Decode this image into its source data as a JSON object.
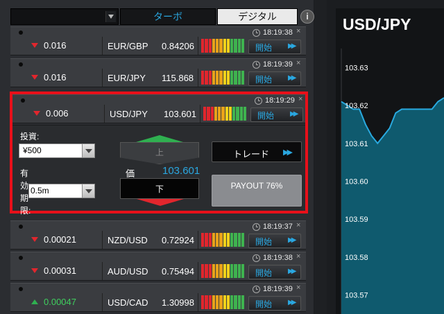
{
  "topbar": {
    "tab_turbo": "ターボ",
    "tab_digital": "デジタル",
    "info_label": "i"
  },
  "rows_top": [
    {
      "time": "18:19:38",
      "direction": "down",
      "change": "0.016",
      "pair": "EUR/GBP",
      "price": "0.84206",
      "button": "開始"
    },
    {
      "time": "18:19:39",
      "direction": "down",
      "change": "0.016",
      "pair": "EUR/JPY",
      "price": "115.868",
      "button": "開始"
    }
  ],
  "expanded": {
    "time": "18:19:29",
    "direction": "down",
    "change": "0.006",
    "pair": "USD/JPY",
    "price": "103.601",
    "button": "開始",
    "label_investment": "投資:",
    "amount_value": "¥500",
    "label_period": "有効期限:",
    "period_value": "0.5m",
    "up_label": "上",
    "down_label": "下",
    "price_label": "価",
    "price_value": "103.601",
    "trade_label": "トレード",
    "payout_text": "PAYOUT 76%"
  },
  "rows_bottom": [
    {
      "time": "18:19:37",
      "direction": "down",
      "change": "0.00021",
      "pair": "NZD/USD",
      "price": "0.72924",
      "button": "開始"
    },
    {
      "time": "18:19:38",
      "direction": "down",
      "change": "0.00031",
      "pair": "AUD/USD",
      "price": "0.75494",
      "button": "開始"
    },
    {
      "time": "18:19:39",
      "direction": "up",
      "change": "0.00047",
      "pair": "USD/CAD",
      "price": "1.30998",
      "button": "開始"
    }
  ],
  "signal_colors": [
    "#e2262d",
    "#e2262d",
    "#e2262d",
    "#e8a21a",
    "#e8a21a",
    "#e8a21a",
    "#f2d21b",
    "#f2d21b",
    "#3fb34f",
    "#3fb34f",
    "#3fb34f",
    "#3fb34f"
  ],
  "chart": {
    "title": "USD/JPY",
    "y_ticks": [
      "103.63",
      "103.62",
      "103.61",
      "103.60",
      "103.59",
      "103.58",
      "103.57"
    ],
    "line_color": "#29a9df",
    "fill_color": "#0f5a6e"
  },
  "chart_data": {
    "type": "area",
    "title": "USD/JPY",
    "ylim": [
      103.565,
      103.635
    ],
    "y_ticks": [
      103.63,
      103.62,
      103.61,
      103.6,
      103.59,
      103.58,
      103.57
    ],
    "values": [
      103.621,
      103.62,
      103.619,
      103.619,
      103.615,
      103.612,
      103.61,
      103.612,
      103.614,
      103.618,
      103.619,
      103.619,
      103.619,
      103.619,
      103.619,
      103.619,
      103.621,
      103.622
    ],
    "grid": false
  }
}
